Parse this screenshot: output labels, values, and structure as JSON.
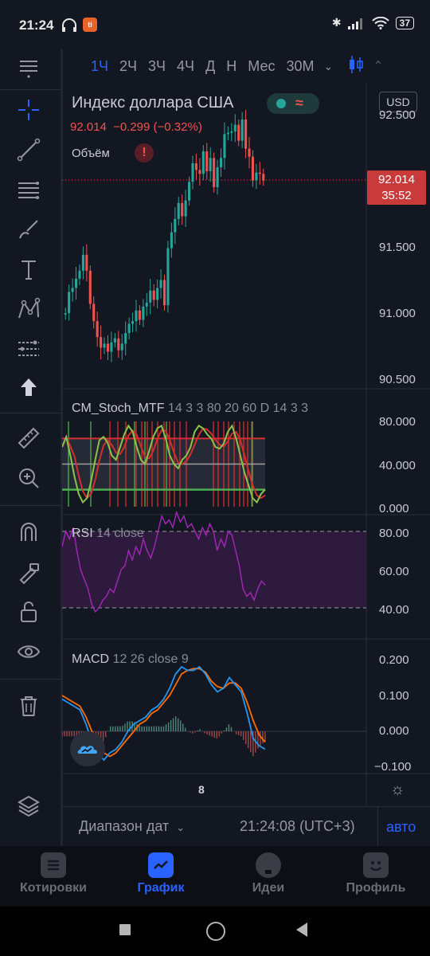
{
  "status_bar": {
    "time": "21:24",
    "battery": "37",
    "app_badge": "ti"
  },
  "intervals": {
    "items": [
      "1Ч",
      "2Ч",
      "3Ч",
      "4Ч",
      "Д",
      "Н",
      "Мес",
      "30М"
    ],
    "active": "1Ч"
  },
  "legend": {
    "title": "Индекс доллара США",
    "price": "92.014",
    "change": "−0.299 (−0.32%)",
    "volume_label": "Объём",
    "currency": "USD"
  },
  "indicators": {
    "stoch": {
      "name": "CM_Stoch_MTF",
      "params": "14 3 3 80 20 60 D 14 3 3"
    },
    "rsi": {
      "name": "RSI",
      "params": "14 close"
    },
    "macd": {
      "name": "MACD",
      "params": "12 26 close 9"
    }
  },
  "price_axis": [
    "92.500",
    "92.000",
    "91.500",
    "91.000",
    "90.500"
  ],
  "price_tag": {
    "price": "92.014",
    "countdown": "35:52"
  },
  "stoch_axis": [
    "80.000",
    "40.000",
    "0.000"
  ],
  "rsi_axis": [
    "80.00",
    "60.00",
    "40.00"
  ],
  "macd_axis": [
    "0.200",
    "0.100",
    "0.000",
    "−0.100"
  ],
  "time_axis": {
    "label": "8"
  },
  "date_bar": {
    "range": "Диапазон дат",
    "clock": "21:24:08 (UTC+3)",
    "auto": "авто"
  },
  "bottom_nav": [
    {
      "label": "Котировки",
      "icon": "quotes-icon"
    },
    {
      "label": "График",
      "icon": "chart-icon",
      "active": true
    },
    {
      "label": "Идеи",
      "icon": "ideas-icon"
    },
    {
      "label": "Профиль",
      "icon": "profile-icon"
    }
  ],
  "colors": {
    "background": "#131722",
    "up": "#26a69a",
    "down": "#ef5350",
    "accent": "#2962ff",
    "rsi": "#9c27b0",
    "macd": "#2196f3",
    "signal": "#ff6d00"
  },
  "chart_data": {
    "type": "candlestick",
    "symbol": "Индекс доллара США",
    "currency": "USD",
    "last_price": 92.014,
    "change": -0.299,
    "change_pct": -0.32,
    "price_range": [
      90.45,
      92.6
    ],
    "x_tick": "8",
    "closes": [
      91.01,
      91.17,
      91.2,
      91.27,
      91.33,
      91.45,
      91.33,
      91.08,
      90.95,
      90.83,
      90.75,
      90.78,
      90.72,
      90.79,
      90.82,
      90.73,
      90.78,
      90.86,
      90.93,
      90.95,
      91.03,
      90.96,
      91.06,
      91.09,
      91.18,
      91.11,
      91.2,
      91.26,
      91.07,
      91.5,
      91.62,
      91.72,
      91.84,
      91.74,
      91.86,
      92.0,
      92.14,
      92.09,
      92.06,
      92.23,
      92.08,
      92.18,
      91.96,
      92.11,
      92.18,
      92.36,
      92.37,
      92.38,
      92.43,
      92.31,
      92.47,
      92.25,
      92.19,
      92.01,
      92.07,
      92.06,
      92.01
    ],
    "stoch_levels": [
      80,
      50,
      20
    ],
    "rsi_band": [
      70,
      30
    ],
    "rsi_range": [
      25,
      88
    ],
    "macd_range": [
      -0.13,
      0.23
    ]
  }
}
